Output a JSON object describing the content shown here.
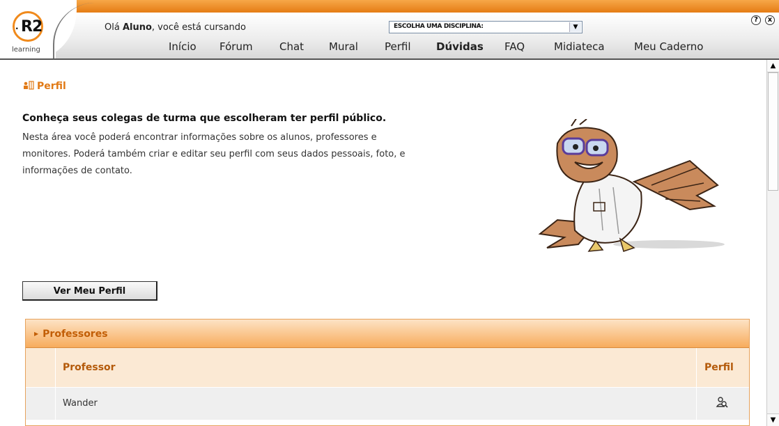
{
  "header": {
    "logo_text": "R2",
    "logo_sub": "learning",
    "greeting_prefix": "Olá ",
    "user": "Aluno",
    "greeting_suffix": ", você está cursando",
    "discipline_select": "ESCOLHA UMA DISCIPLINA:",
    "help_icon": "?",
    "close_icon": "x",
    "nav": [
      "Início",
      "Fórum",
      "Chat",
      "Mural",
      "Perfil",
      "Dúvidas",
      "FAQ",
      "Midiateca",
      "Meu Caderno"
    ]
  },
  "page": {
    "section_title": "Perfil",
    "intro_title": "Conheça seus colegas de turma que escolheram ter perfil público.",
    "intro_lines": [
      "Nesta área você poderá encontrar informações sobre os alunos, professores e",
      "monitores. Poderá também criar e editar seu perfil com seus dados pessoais, foto, e",
      "informações de contato."
    ],
    "view_profile_button": "Ver Meu Perfil"
  },
  "panel": {
    "title": "Professores",
    "col_professor": "Professor",
    "col_perfil": "Perfil",
    "rows": [
      {
        "name": "Wander",
        "profile_icon": "profile-icon"
      }
    ]
  },
  "colors": {
    "accent": "#e57c14",
    "panel_text": "#b45a0a"
  }
}
